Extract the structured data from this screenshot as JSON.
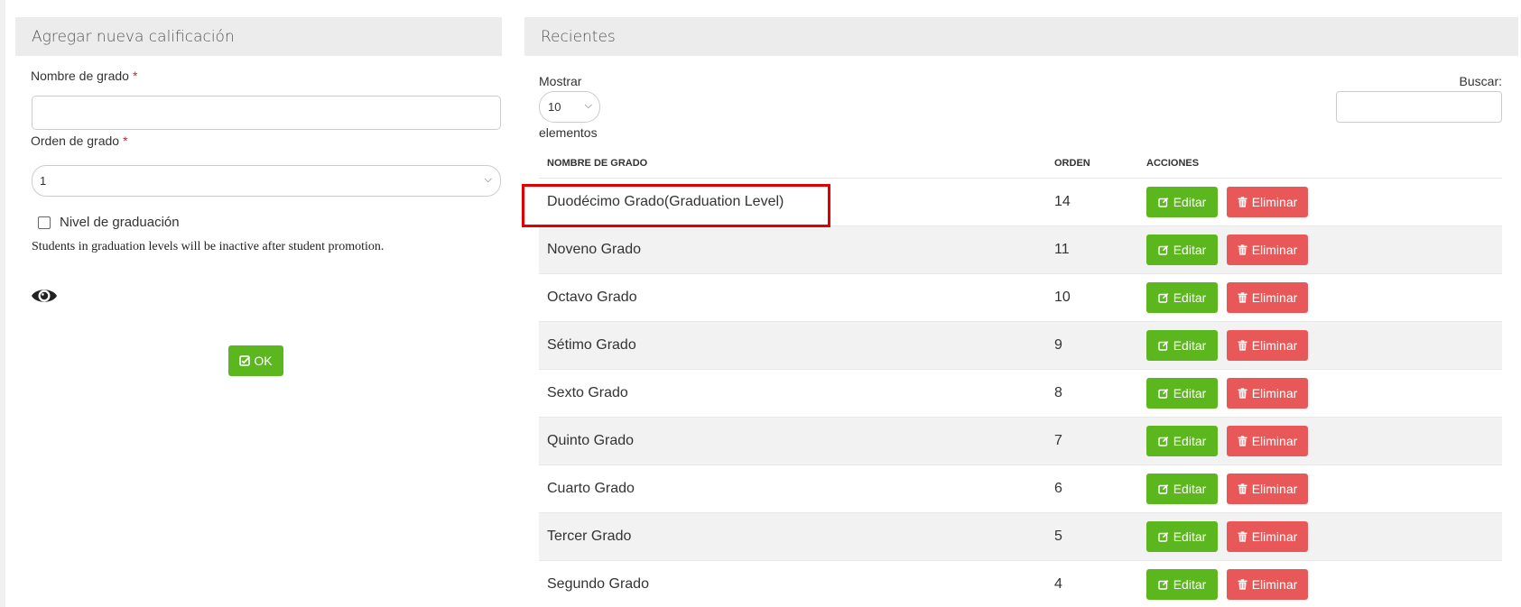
{
  "form": {
    "title": "Agregar nueva calificación",
    "name_label": "Nombre de grado",
    "name_value": "",
    "order_label": "Orden de grado",
    "order_value": "1",
    "required_mark": "*",
    "graduation_label": "Nivel de graduación",
    "graduation_checked": false,
    "help_text": "Students in graduation levels will be inactive after student promotion.",
    "ok_label": "OK"
  },
  "recent": {
    "title": "Recientes",
    "show_label": "Mostrar",
    "page_length": "10",
    "elements_label": "elementos",
    "search_label": "Buscar:",
    "search_value": "",
    "columns": {
      "name": "NOMBRE DE GRADO",
      "order": "ORDEN",
      "actions": "ACCIONES"
    },
    "edit_label": "Editar",
    "delete_label": "Eliminar",
    "rows": [
      {
        "name": "Duodécimo Grado(Graduation Level)",
        "order": "14"
      },
      {
        "name": "Noveno Grado",
        "order": "11"
      },
      {
        "name": "Octavo Grado",
        "order": "10"
      },
      {
        "name": "Sétimo Grado",
        "order": "9"
      },
      {
        "name": "Sexto Grado",
        "order": "8"
      },
      {
        "name": "Quinto Grado",
        "order": "7"
      },
      {
        "name": "Cuarto Grado",
        "order": "6"
      },
      {
        "name": "Tercer Grado",
        "order": "5"
      },
      {
        "name": "Segundo Grado",
        "order": "4"
      }
    ]
  },
  "colors": {
    "success": "#5cb61d",
    "danger": "#e85858",
    "highlight": "#e00000",
    "header_bg": "#ececec"
  }
}
